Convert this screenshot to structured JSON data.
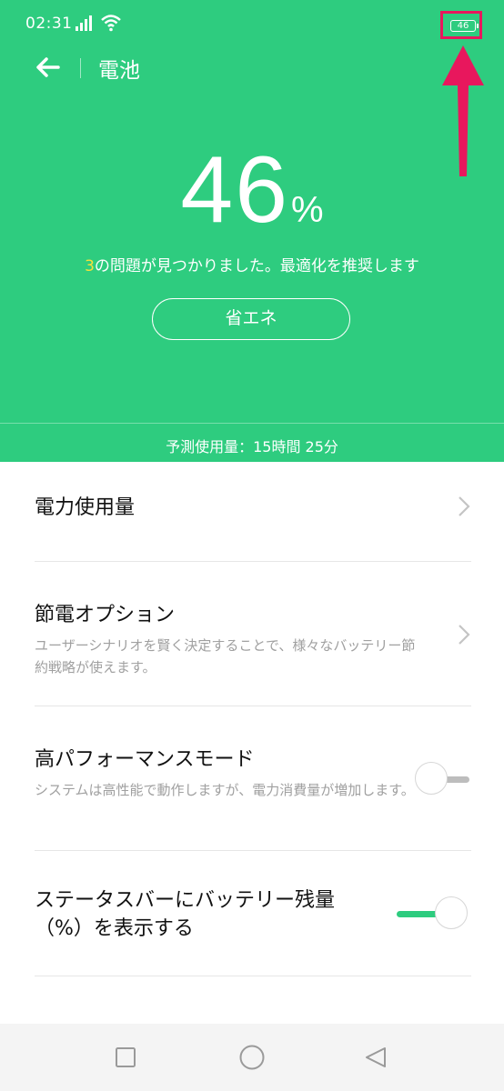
{
  "status_bar": {
    "time": "02:31",
    "battery_level": "46"
  },
  "header": {
    "title": "電池"
  },
  "battery": {
    "percent": "46",
    "percent_sign": "%"
  },
  "problems": {
    "count": "3",
    "text": "の問題が見つかりました。最適化を推奨します"
  },
  "eco_button": {
    "label": "省エネ"
  },
  "estimate": {
    "text": "予測使用量：15時間 25分"
  },
  "settings": {
    "usage": {
      "title": "電力使用量"
    },
    "saving": {
      "title": "節電オプション",
      "desc": "ユーザーシナリオを賢く決定することで、様々なバッテリー節約戦略が使えます。"
    },
    "performance": {
      "title": "高パフォーマンスモード",
      "desc": "システムは高性能で動作しますが、電力消費量が増加します。",
      "enabled": false
    },
    "statusbar_percent": {
      "title": "ステータスバーにバッテリー残量（%）を表示する",
      "enabled": true
    }
  },
  "colors": {
    "accent": "#2ecc7f",
    "highlight_box": "#e8175d",
    "problem_count": "#f6e23a"
  },
  "icons": [
    "signal-icon",
    "wifi-icon",
    "battery-icon",
    "back-arrow-icon",
    "chevron-right-icon",
    "square-nav-icon",
    "circle-nav-icon",
    "triangle-nav-icon",
    "annotation-arrow-icon"
  ]
}
